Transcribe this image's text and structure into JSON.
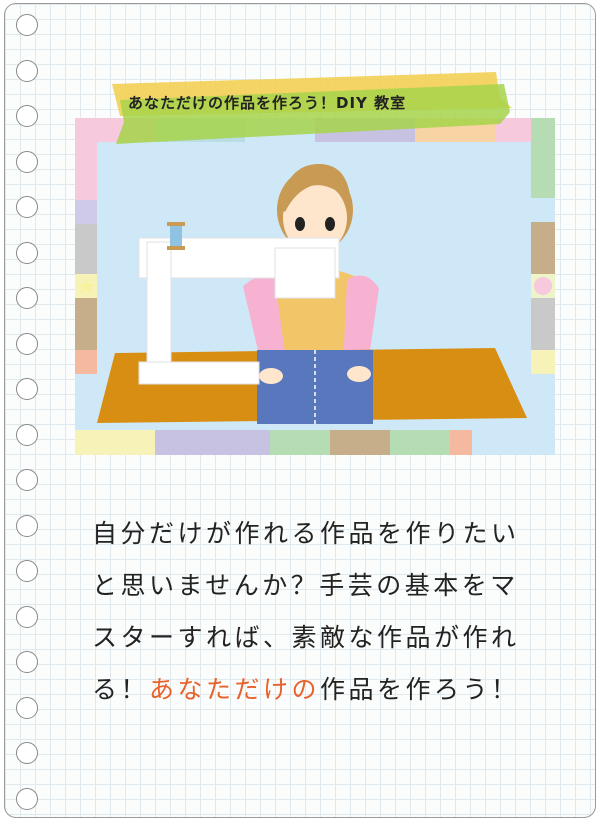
{
  "banner": {
    "title": "あなただけの作品を作ろう！DIY 教室"
  },
  "description": {
    "line1": "自分だけが作れる作品を作りたい",
    "line2": "と思いませんか？手芸の基本をマ",
    "line3": "スターすれば、素敵な作品が作れ",
    "line4_prefix": "る！",
    "line4_highlight": "あなただけの",
    "line4_suffix": "作品を作ろう！"
  },
  "colors": {
    "accent": "#e8632c",
    "tape_green": "#a6d34a",
    "tape_yellow": "#f3cf54",
    "table": "#d88e12",
    "jeans": "#5877bd",
    "sky": "#cfe8f8"
  },
  "icons": [
    "ring-hole-icon",
    "star-icon",
    "spool-icon"
  ]
}
